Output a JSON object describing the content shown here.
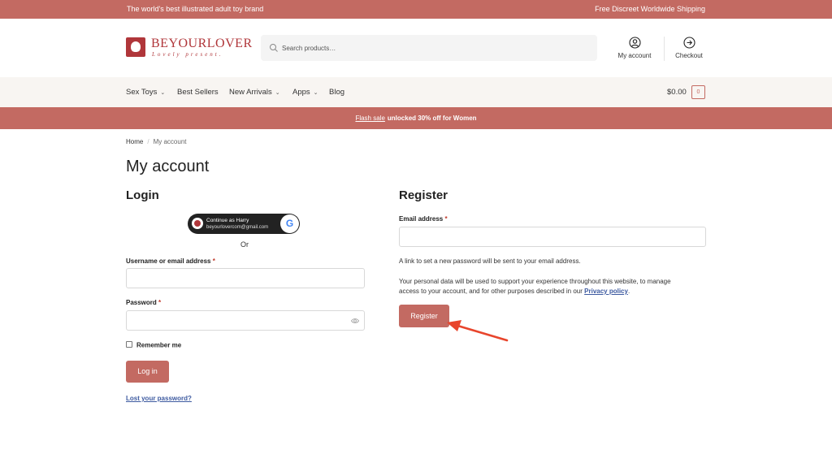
{
  "topbar": {
    "left_text": "The world's best illustrated adult toy brand",
    "right_text": "Free Discreet Worldwide Shipping"
  },
  "logo": {
    "brand": "BEYOURLOVER",
    "tagline": "Lovely present."
  },
  "search": {
    "placeholder": "Search products…"
  },
  "header_links": {
    "account": "My account",
    "checkout": "Checkout"
  },
  "nav": {
    "items": [
      {
        "label": "Sex Toys",
        "has_dropdown": true
      },
      {
        "label": "Best Sellers",
        "has_dropdown": false
      },
      {
        "label": "New Arrivals",
        "has_dropdown": true
      },
      {
        "label": "Apps",
        "has_dropdown": true
      },
      {
        "label": "Blog",
        "has_dropdown": false
      }
    ],
    "dropdown_glyph": "⌄",
    "cart_total": "$0.00",
    "cart_count": "0"
  },
  "promo": {
    "link_text": "Flash sale",
    "text": "unlocked 30% off for Women"
  },
  "breadcrumb": {
    "home": "Home",
    "separator": "/",
    "current": "My account"
  },
  "page_title": "My account",
  "login": {
    "title": "Login",
    "google": {
      "line1": "Continue as Harry",
      "line2": "beyourlovercom@gmail.com",
      "logo_letter": "G"
    },
    "or_text": "Or",
    "username_label": "Username or email address",
    "password_label": "Password",
    "required_mark": "*",
    "remember_label": "Remember me",
    "login_button": "Log in",
    "lost_password": "Lost your password?"
  },
  "register": {
    "title": "Register",
    "email_label": "Email address",
    "required_mark": "*",
    "note": "A link to set a new password will be sent to your email address.",
    "privacy_text": "Your personal data will be used to support your experience throughout this website, to manage access to your account, and for other purposes described in our",
    "privacy_link": "Privacy policy",
    "privacy_end": ".",
    "button": "Register"
  },
  "colors": {
    "accent": "#c36a62",
    "brand": "#b0363a",
    "link": "#3d5aa0",
    "annotation_arrow": "#e8452c",
    "nav_bg": "#f8f5f2"
  },
  "icons": {
    "search": "search-icon",
    "account": "user-circle-icon",
    "checkout": "arrow-circle-right-icon",
    "password_toggle": "eye-icon",
    "annotation": "red-arrow-icon"
  }
}
